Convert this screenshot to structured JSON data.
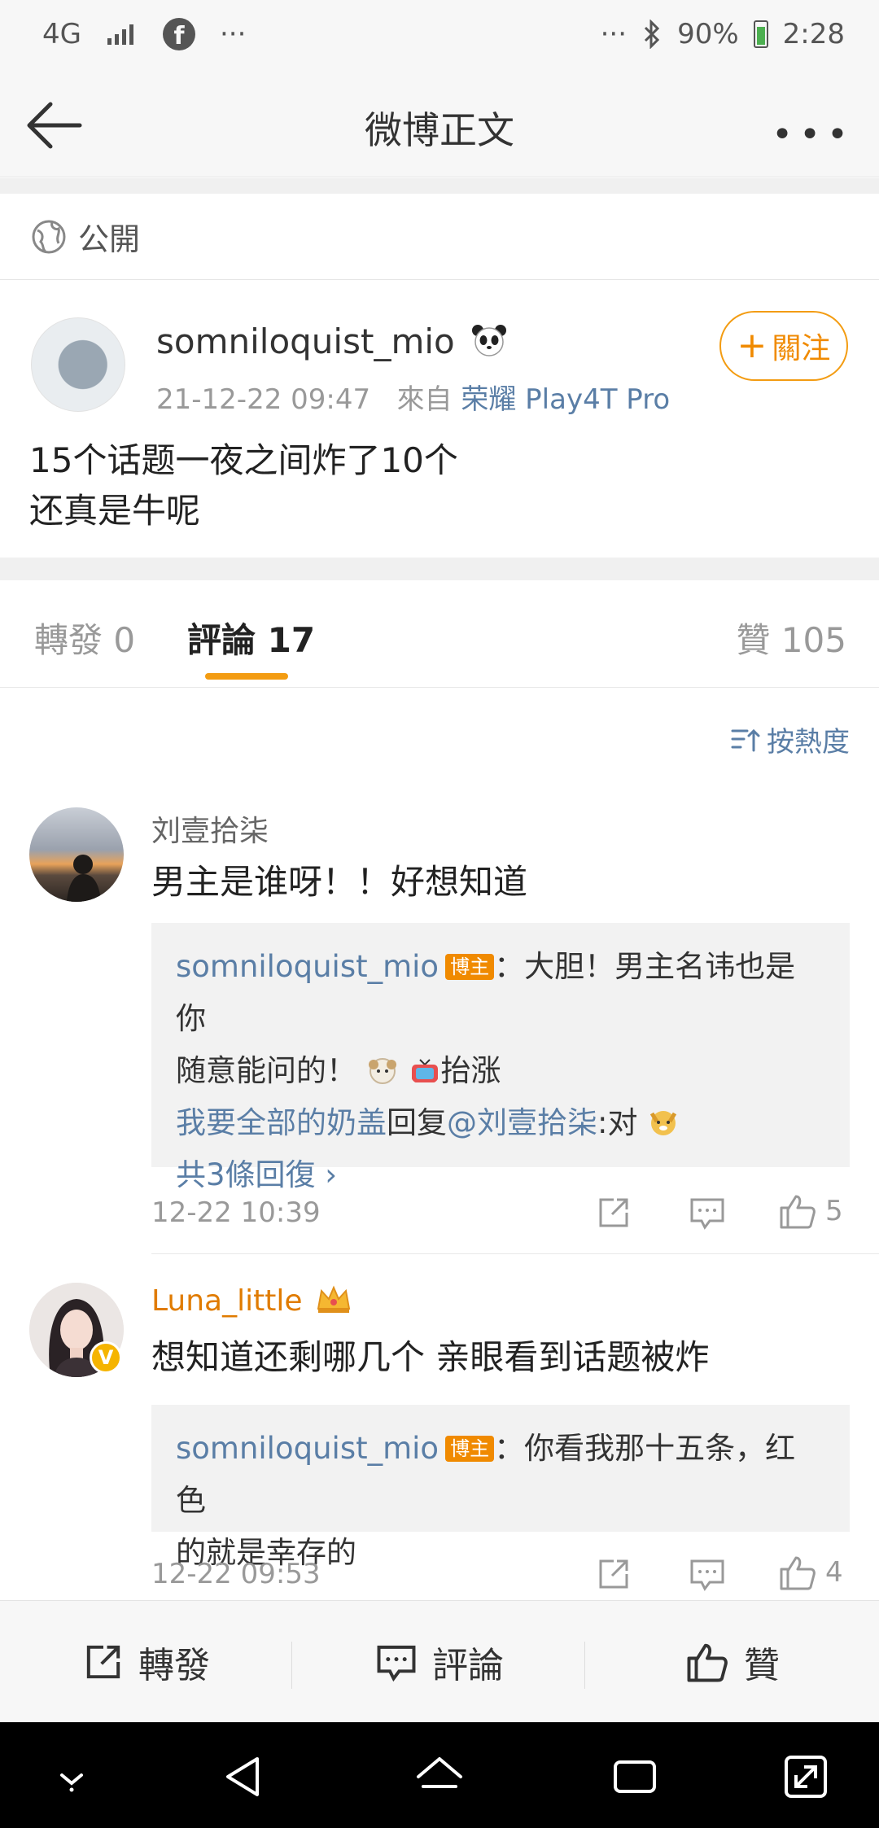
{
  "status_bar": {
    "network": "4G",
    "fb_glyph": "f",
    "left_more": "···",
    "right_more": "···",
    "battery": "90%",
    "time": "2:28",
    "battery_color": "#4caf50"
  },
  "nav": {
    "title": "微博正文",
    "more": "•••"
  },
  "visibility": {
    "label": "公開"
  },
  "post": {
    "username": "somniloquist_mio",
    "timestamp": "21-12-22 09:47",
    "from_prefix": "來自",
    "device": "荣耀 Play4T Pro",
    "follow_label": "關注",
    "follow_plus": "+",
    "text_line1": "15个话题一夜之间炸了10个",
    "text_line2": "还真是牛呢"
  },
  "tabs": {
    "repost": "轉發 0",
    "comments": "評論 17",
    "likes": "贊 105"
  },
  "sort": {
    "label": "按熱度"
  },
  "comments": [
    {
      "name": "刘壹拾柒",
      "text": "男主是谁呀！！好想知道",
      "reply": {
        "author": "somniloquist_mio",
        "badge": "博主",
        "text_a": "：大胆！男主名讳也是你",
        "text_b": "随意能问的！",
        "text_c": "抬涨",
        "sub_author": "我要全部的奶盖",
        "sub_verb": "回复",
        "sub_mention": "@刘壹拾柒",
        "sub_text": ":对",
        "more": "共3條回復 ›"
      },
      "time": "12-22 10:39",
      "likes": "5"
    },
    {
      "name": "Luna_little",
      "text": "想知道还剩哪几个 亲眼看到话题被炸",
      "reply": {
        "author": "somniloquist_mio",
        "badge": "博主",
        "text_a": "：你看我那十五条，红色",
        "text_b": "的就是幸存的"
      },
      "time": "12-22 09:53",
      "likes": "4"
    }
  ],
  "bottom_bar": {
    "repost": "轉發",
    "comment": "評論",
    "like": "贊"
  },
  "colors": {
    "accent": "#f39c12",
    "link": "#5a7ea6",
    "vip_name": "#e07b00"
  }
}
